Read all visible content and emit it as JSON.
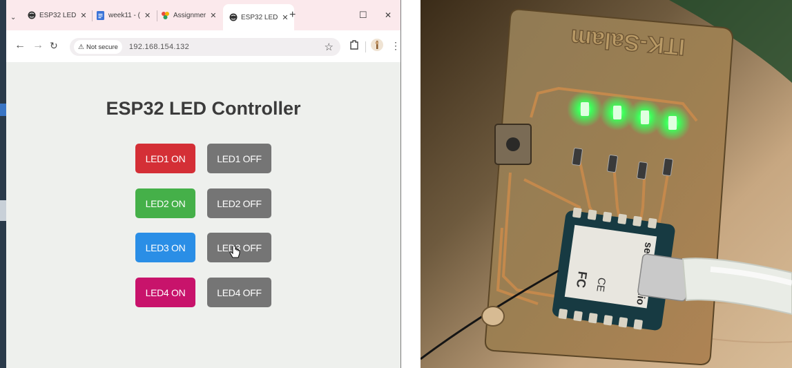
{
  "tabs": [
    {
      "label": "ESP32 LED",
      "icon": "globe-icon"
    },
    {
      "label": "week11 - (",
      "icon": "docs-icon"
    },
    {
      "label": "Assignmer",
      "icon": "colorful-logo-icon"
    },
    {
      "label": "ESP32 LED",
      "icon": "globe-icon",
      "active": true
    }
  ],
  "toolbar": {
    "security_label": "Not secure",
    "url": "192.168.154.132"
  },
  "page": {
    "title": "ESP32 LED Controller",
    "buttons": [
      {
        "on": "LED1 ON",
        "off": "LED1 OFF",
        "color": "#d42f36"
      },
      {
        "on": "LED2 ON",
        "off": "LED2 OFF",
        "color": "#45b049"
      },
      {
        "on": "LED3 ON",
        "off": "LED3 OFF",
        "color": "#2a8ee6"
      },
      {
        "on": "LED4 ON",
        "off": "LED4 OFF",
        "color": "#c8136b"
      }
    ],
    "off_color": "#757575"
  },
  "photo": {
    "board_engraving": "ITK-Salam",
    "module_brand": "seeed studio",
    "led_color": "#3dff5a"
  }
}
